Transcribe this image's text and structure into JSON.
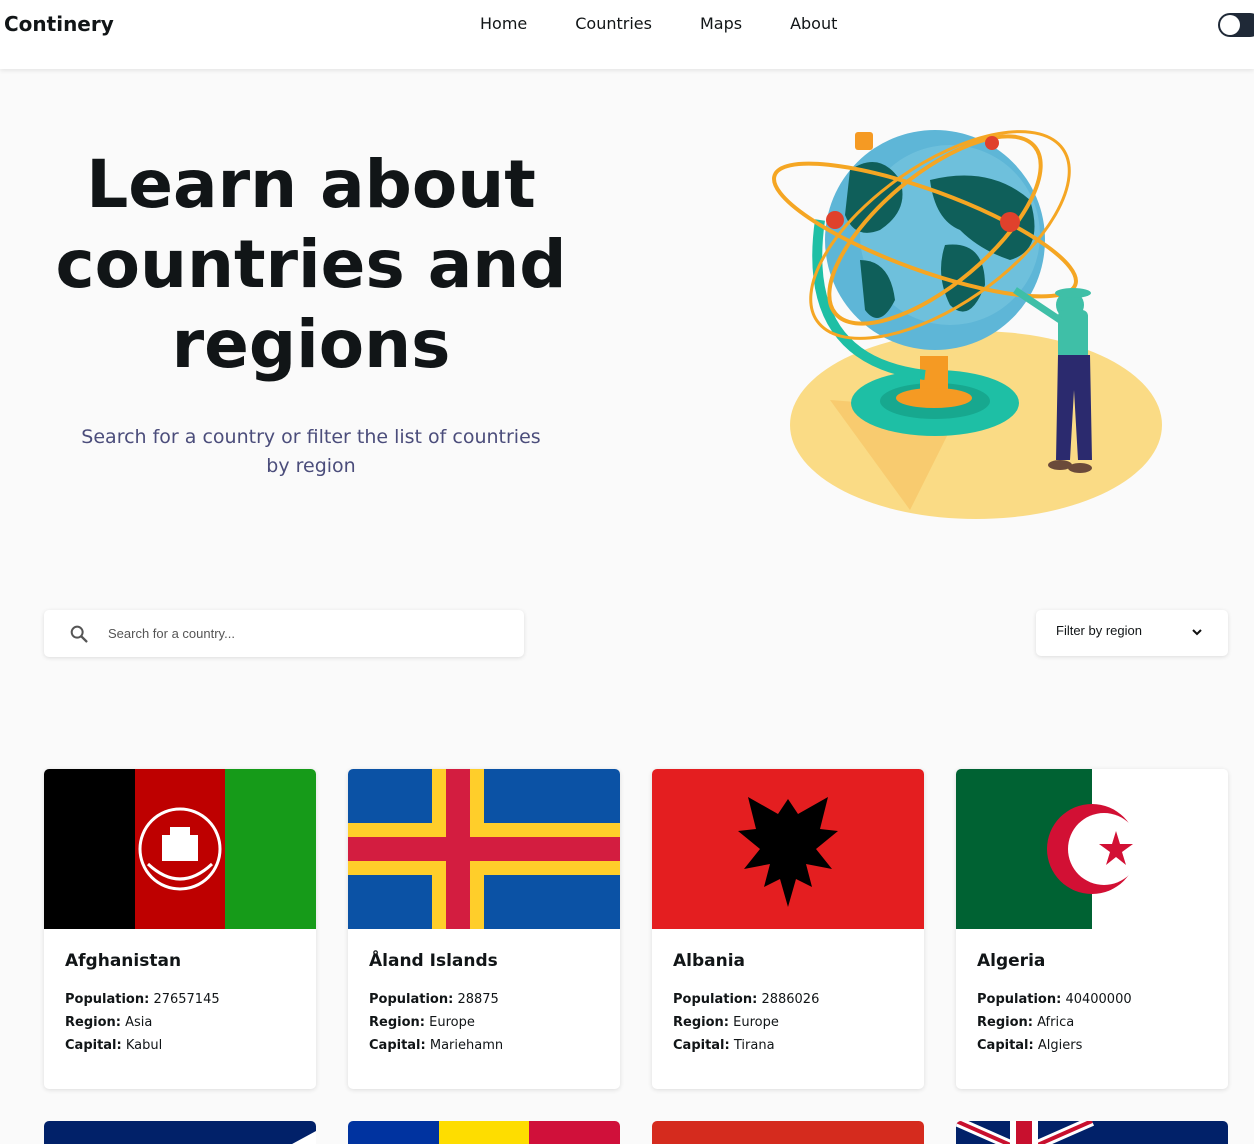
{
  "brand": "Continery",
  "nav": {
    "home": "Home",
    "countries": "Countries",
    "maps": "Maps",
    "about": "About"
  },
  "hero": {
    "title": "Learn about countries and regions",
    "subtitle": "Search for a country or filter the list of countries by region"
  },
  "search": {
    "placeholder": "Search for a country...",
    "value": ""
  },
  "filter": {
    "label": "Filter by region"
  },
  "labels": {
    "population": "Population:",
    "region": "Region:",
    "capital": "Capital:"
  },
  "countries": [
    {
      "name": "Afghanistan",
      "population": "27657145",
      "region": "Asia",
      "capital": "Kabul"
    },
    {
      "name": "Åland Islands",
      "population": "28875",
      "region": "Europe",
      "capital": "Mariehamn"
    },
    {
      "name": "Albania",
      "population": "2886026",
      "region": "Europe",
      "capital": "Tirana"
    },
    {
      "name": "Algeria",
      "population": "40400000",
      "region": "Africa",
      "capital": "Algiers"
    }
  ],
  "colors": {
    "background": "#fafafa",
    "text": "#111517",
    "subtitle": "#4b4d7b"
  }
}
